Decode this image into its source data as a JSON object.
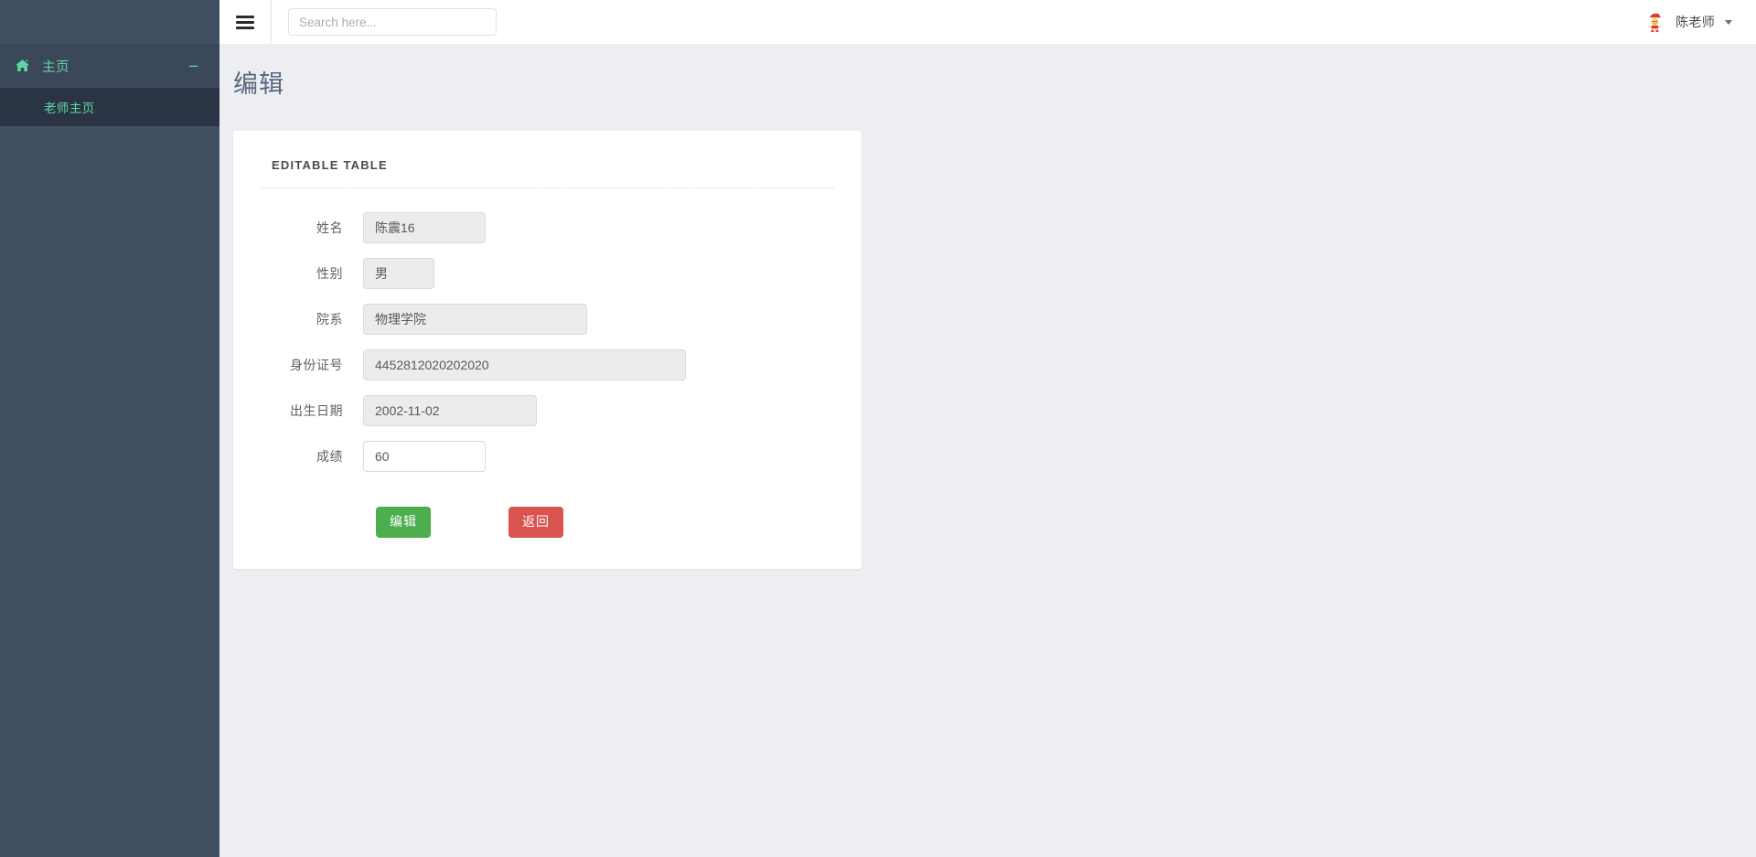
{
  "header": {
    "menu_toggle_icon": "hamburger-icon",
    "search": {
      "placeholder": "Search here...",
      "value": ""
    },
    "user": {
      "name": "陈老师",
      "avatar_icon": "user-avatar-cartoon",
      "caret_icon": "chevron-down-icon"
    }
  },
  "sidebar": {
    "items": [
      {
        "label": "主页",
        "icon": "home-icon",
        "toggle_icon": "minus-icon",
        "toggle_symbol": "−",
        "children": [
          {
            "label": "老师主页"
          }
        ]
      }
    ]
  },
  "main": {
    "page_title": "编辑",
    "card": {
      "title": "EDITABLE TABLE",
      "fields": [
        {
          "label": "姓名",
          "value": "陈震16",
          "editable": false,
          "width_class": "w-name"
        },
        {
          "label": "性别",
          "value": "男",
          "editable": false,
          "width_class": "w-sex"
        },
        {
          "label": "院系",
          "value": "物理学院",
          "editable": false,
          "width_class": "w-dept"
        },
        {
          "label": "身份证号",
          "value": "4452812020202020",
          "editable": false,
          "width_class": "w-id"
        },
        {
          "label": "出生日期",
          "value": "2002-11-02",
          "editable": false,
          "width_class": "w-birth"
        },
        {
          "label": "成绩",
          "value": "60",
          "editable": true,
          "width_class": "w-score"
        }
      ],
      "buttons": {
        "submit_label": "编辑",
        "back_label": "返回"
      }
    }
  },
  "colors": {
    "sidebar_bg": "#414f63",
    "sidebar_item_bg": "#3a4859",
    "sidebar_subitem_bg": "#2b3444",
    "sidebar_accent": "#5fd6a5",
    "content_bg": "#edeef2",
    "page_title": "#56677f",
    "btn_success": "#4cae4c",
    "btn_danger": "#d9534f"
  }
}
